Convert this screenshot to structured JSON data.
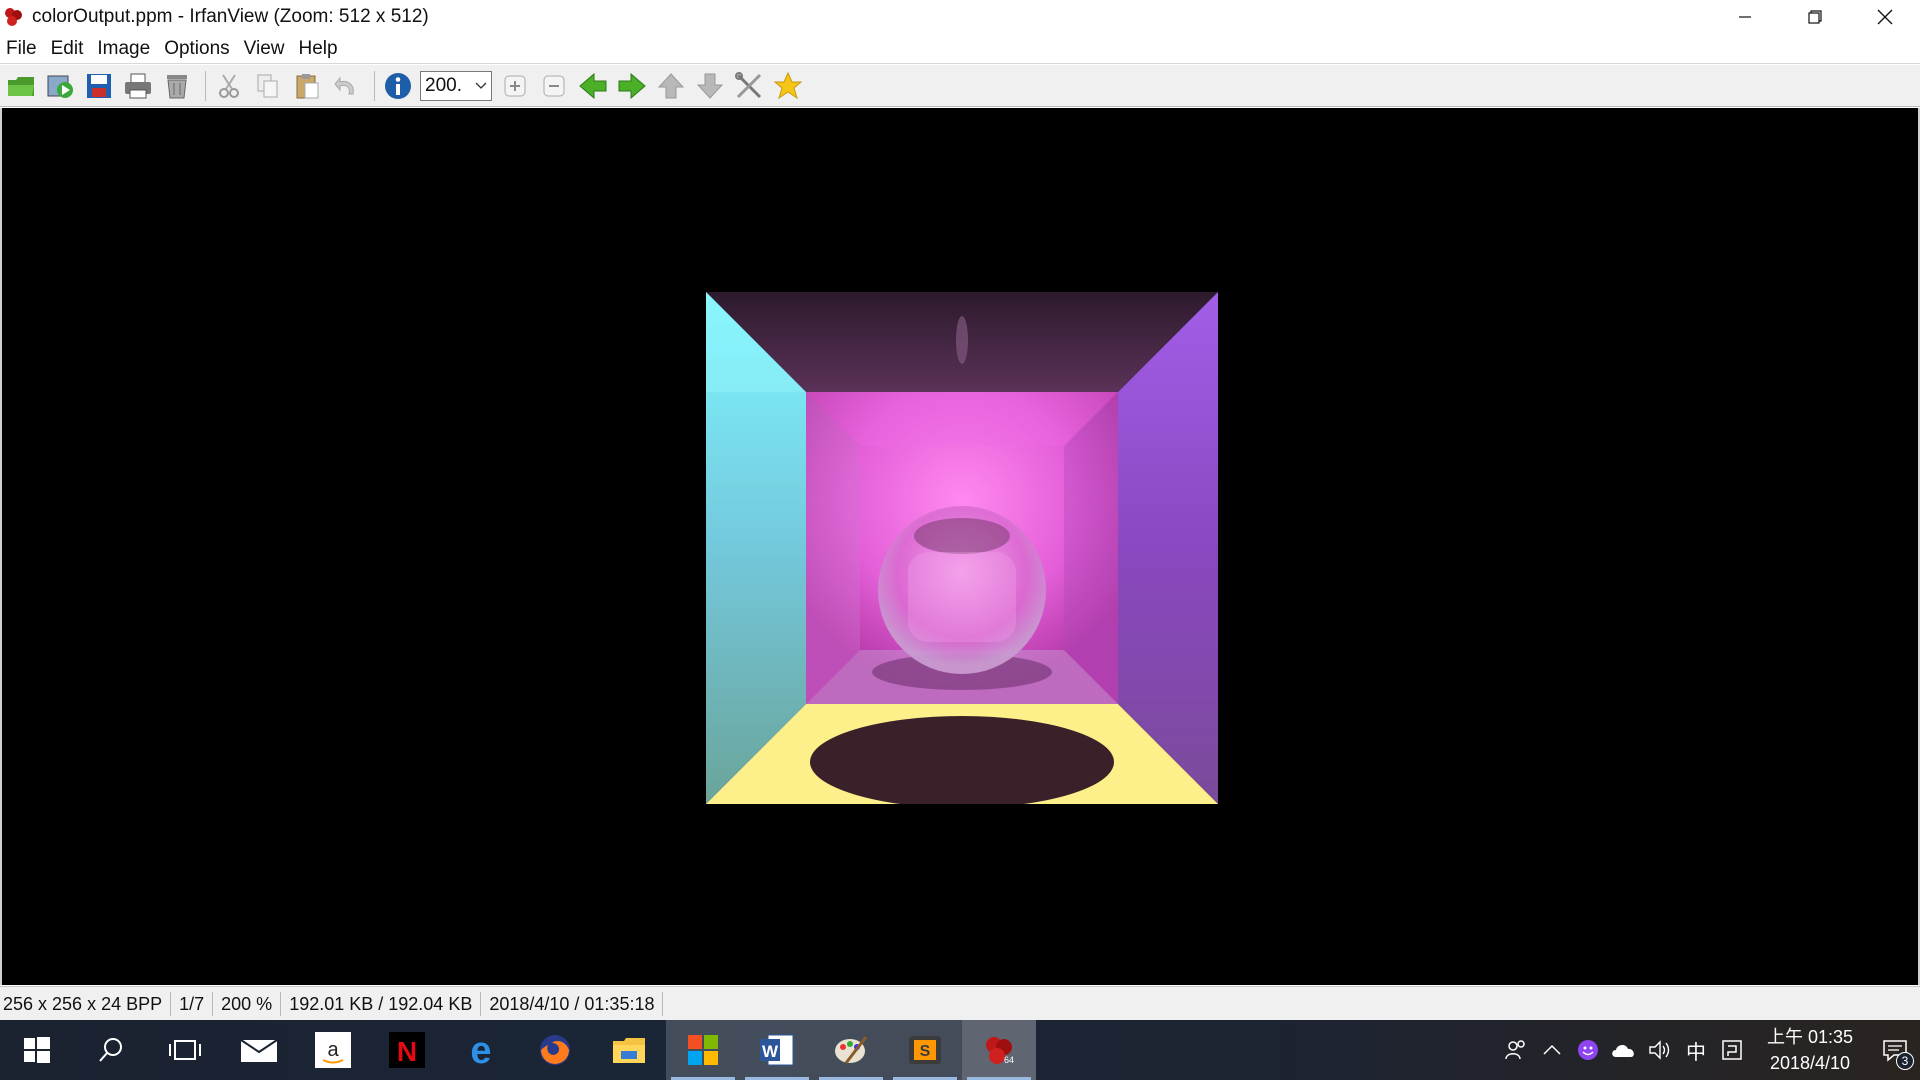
{
  "window": {
    "title": "colorOutput.ppm - IrfanView (Zoom: 512 x 512)"
  },
  "menu": {
    "items": [
      "File",
      "Edit",
      "Image",
      "Options",
      "View",
      "Help"
    ]
  },
  "toolbar": {
    "zoom_value": "200.",
    "icons": [
      "open-folder-icon",
      "slideshow-icon",
      "save-icon",
      "print-icon",
      "delete-icon",
      "cut-icon",
      "copy-icon",
      "paste-icon",
      "undo-icon",
      "info-icon",
      "zoom-in-icon",
      "zoom-out-icon",
      "previous-icon",
      "next-icon",
      "first-icon",
      "last-icon",
      "settings-icon",
      "favorite-icon"
    ]
  },
  "status": {
    "dimensions": "256 x 256 x 24 BPP",
    "index": "1/7",
    "zoom": "200 %",
    "size": "192.01 KB / 192.04 KB",
    "datetime": "2018/4/10 / 01:35:18"
  },
  "taskbar": {
    "apps": [
      "start-icon",
      "search-icon",
      "task-view-icon",
      "mail-icon",
      "amazon-icon",
      "netflix-icon",
      "edge-icon",
      "firefox-icon",
      "file-explorer-icon",
      "store-icon",
      "word-icon",
      "paint-icon",
      "sublime-icon",
      "irfanview-icon"
    ],
    "clock_time": "上午 01:35",
    "clock_date": "2018/4/10",
    "ime": "中",
    "notification_count": "3"
  }
}
